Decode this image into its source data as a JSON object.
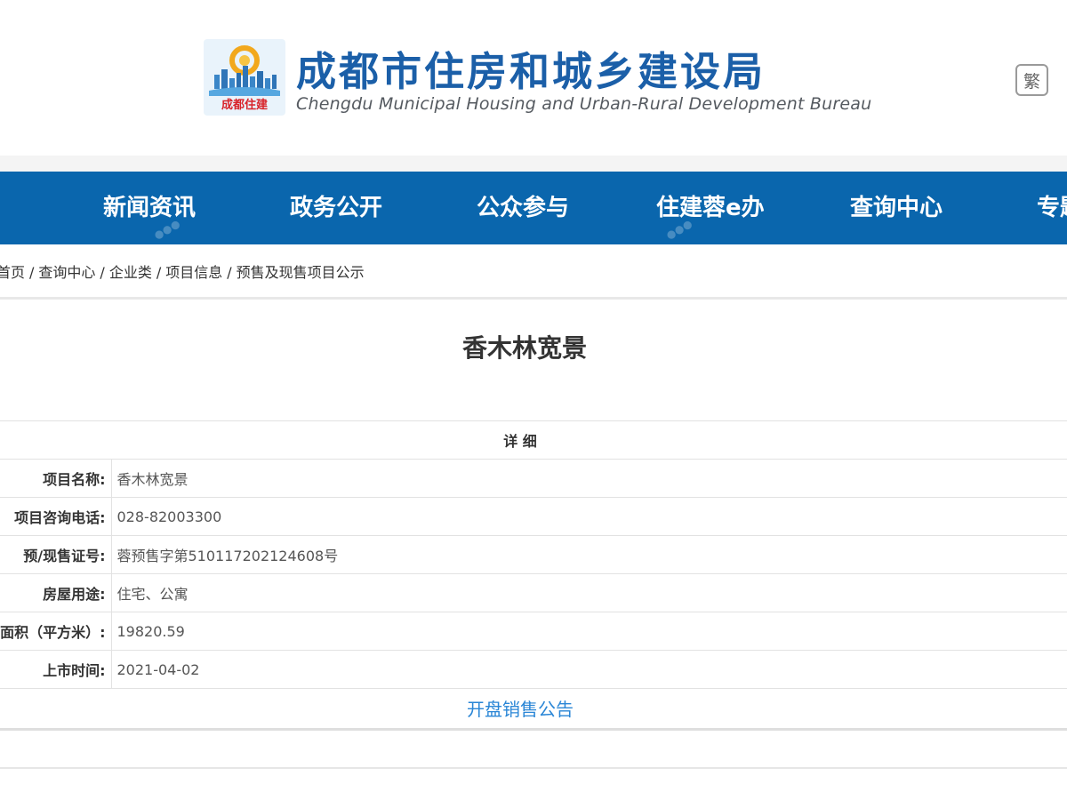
{
  "header": {
    "title": "成都市住房和城乡建设局",
    "subtitle": "Chengdu Municipal Housing and Urban-Rural Development Bureau",
    "logo_text": "成都住建",
    "lang_toggle": "繁"
  },
  "nav": {
    "items": [
      "新闻资讯",
      "政务公开",
      "公众参与",
      "住建蓉e办",
      "查询中心",
      "专题"
    ]
  },
  "breadcrumb": {
    "items": [
      "首页",
      "查询中心",
      "企业类",
      "项目信息",
      "预售及现售项目公示"
    ],
    "separator": "/"
  },
  "page": {
    "title": "香木林宽景"
  },
  "detail": {
    "heading": "详 细",
    "rows": [
      {
        "label": "项目名称:",
        "value": "香木林宽景"
      },
      {
        "label": "项目咨询电话:",
        "value": "028-82003300"
      },
      {
        "label": "预/现售证号:",
        "value": "蓉预售字第510117202124608号"
      },
      {
        "label": "房屋用途:",
        "value": "住宅、公寓"
      },
      {
        "label": "面积（平方米）:",
        "value": "19820.59"
      },
      {
        "label": "上市时间:",
        "value": "2021-04-02"
      }
    ],
    "link_label": "开盘销售公告"
  },
  "colors": {
    "nav_bg": "#0a66ad",
    "title_blue": "#1b5fa8",
    "link_blue": "#2a86d6"
  }
}
